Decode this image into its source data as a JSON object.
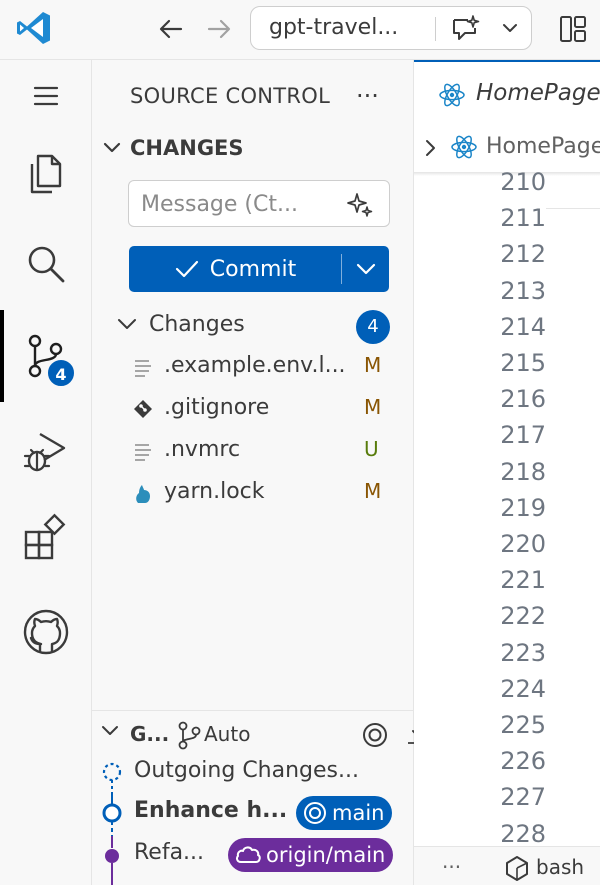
{
  "titlebar": {
    "command_center_label": "gpt-travel...",
    "app_icon": "vscode-logo",
    "icons": [
      "arrow-left-icon",
      "arrow-right-icon",
      "copilot-chat-icon",
      "chevron-down-icon",
      "layout-icon"
    ]
  },
  "activitybar": {
    "items": [
      "menu-icon",
      "explorer-icon",
      "search-icon",
      "source-control-icon",
      "run-debug-icon",
      "extensions-icon",
      "github-icon"
    ],
    "source_control_badge": "4"
  },
  "sidebar": {
    "title": "SOURCE CONTROL",
    "more": "···",
    "changes_header": "CHANGES",
    "message_placeholder": "Message (Ct...",
    "commit_label": "Commit",
    "group_label": "Changes",
    "group_count": "4",
    "files": [
      {
        "name": ".example.env.l...",
        "status": "M",
        "icon": "text-file-icon"
      },
      {
        "name": ".gitignore",
        "status": "M",
        "icon": "git-file-icon"
      },
      {
        "name": ".nvmrc",
        "status": "U",
        "icon": "text-file-icon"
      },
      {
        "name": "yarn.lock",
        "status": "M",
        "icon": "yarn-icon"
      }
    ],
    "graph": {
      "header": "G...",
      "auto_label": "Auto",
      "rows": [
        {
          "text": "Outgoing Changes..."
        },
        {
          "text": "Enhance h...",
          "ref": "main"
        },
        {
          "text": "Refa...",
          "ref": "origin/main"
        }
      ]
    }
  },
  "editor": {
    "tab_label": "HomePage",
    "breadcrumb_label": "HomePage",
    "line_numbers": [
      "210",
      "211",
      "212",
      "213",
      "214",
      "215",
      "216",
      "217",
      "218",
      "219",
      "220",
      "221",
      "222",
      "223",
      "224",
      "225",
      "226",
      "227",
      "228"
    ],
    "panel_dots": "···",
    "terminal_label": "bash"
  },
  "colors": {
    "accent": "#005fb8",
    "modified": "#895503",
    "untracked": "#587c0c",
    "remote_ref": "#6c2d9c"
  }
}
